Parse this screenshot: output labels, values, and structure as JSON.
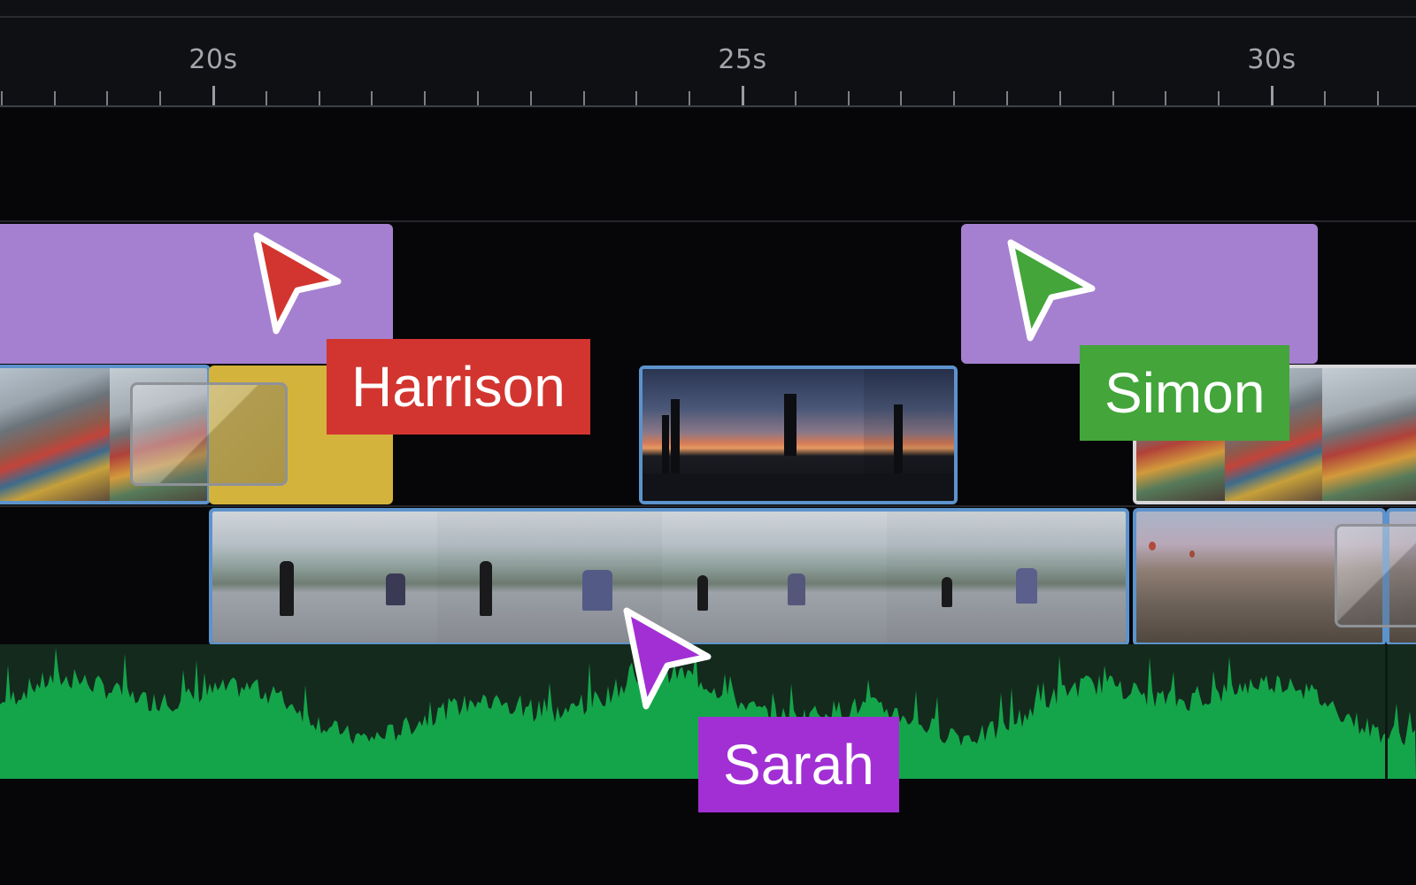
{
  "ruler": {
    "labels": [
      "20s",
      "25s",
      "30s"
    ]
  },
  "collaborators": [
    {
      "name": "Harrison",
      "color": "#d2352f"
    },
    {
      "name": "Simon",
      "color": "#43a53a"
    },
    {
      "name": "Sarah",
      "color": "#a12fd4"
    }
  ],
  "colors": {
    "title_clip": "#a580d0",
    "selected_clip_border": "#5d93cc",
    "gold_clip": "#d4b33c",
    "audio_waveform": "#14a54a",
    "audio_background": "#142a1d"
  },
  "icons": [
    "cursor-arrow-icon",
    "transition-icon"
  ]
}
